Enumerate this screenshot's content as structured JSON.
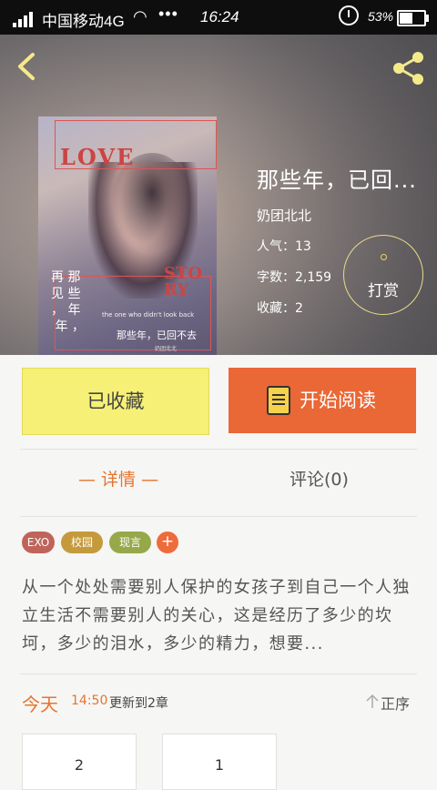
{
  "status_bar": {
    "carrier": "中国移动4G",
    "dots": "•••",
    "time": "16:24",
    "battery": "53%"
  },
  "header": {
    "back_icon": "chevron-left-icon",
    "share_icon": "share-icon"
  },
  "cover": {
    "love": "LOVE",
    "story": "STO\nRY",
    "vertical_text": "再 那\n见 些\n， 年\n 年 ，",
    "tagline": "the one who didn't look back",
    "subtitle": "那些年，已回不去",
    "small_text": "奶团北北"
  },
  "book": {
    "title": "那些年，已回...",
    "author": "奶团北北",
    "popularity": "人气：13",
    "word_count": "字数：2,159",
    "favorites": "收藏：2"
  },
  "tip_button": {
    "label": "打赏"
  },
  "actions": {
    "favorited_label": "已收藏",
    "start_reading_label": "开始阅读"
  },
  "tabs": {
    "detail": "— 详情 —",
    "comments": "评论(0)"
  },
  "tags": [
    "EXO",
    "校园",
    "现言"
  ],
  "add_tag": "+",
  "description": "从一个处处需要别人保护的女孩子到自己一个人独立生活不需要别人的关心，这是经历了多少的坎坷，多少的泪水，多少的精力，想要...",
  "update": {
    "day": "今天",
    "time": "14:50",
    "text": "更新到2章"
  },
  "order_label": "正序",
  "chapters": [
    "2",
    "1"
  ]
}
